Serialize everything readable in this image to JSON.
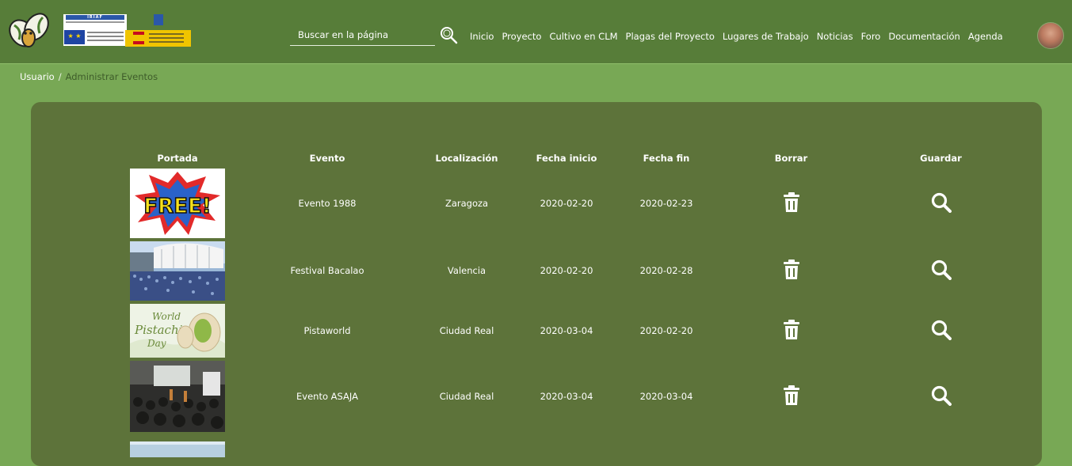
{
  "header": {
    "logo_iriaf_text": "IRIAF",
    "search": {
      "placeholder": "Buscar en la página",
      "value": ""
    },
    "nav": [
      "Inicio",
      "Proyecto",
      "Cultivo en CLM",
      "Plagas del Proyecto",
      "Lugares de Trabajo",
      "Noticias",
      "Foro",
      "Documentación",
      "Agenda"
    ]
  },
  "breadcrumb": {
    "parent": "Usuario",
    "separator": "/",
    "current": "Administrar Eventos"
  },
  "table": {
    "columns": [
      "Portada",
      "Evento",
      "Localización",
      "Fecha inicio",
      "Fecha fin",
      "Borrar",
      "Guardar"
    ],
    "rows": [
      {
        "evento": "Evento 1988",
        "localizacion": "Zaragoza",
        "fecha_inicio": "2020-02-20",
        "fecha_fin": "2020-02-23"
      },
      {
        "evento": "Festival Bacalao",
        "localizacion": "Valencia",
        "fecha_inicio": "2020-02-20",
        "fecha_fin": "2020-02-28"
      },
      {
        "evento": "Pistaworld",
        "localizacion": "Ciudad Real",
        "fecha_inicio": "2020-03-04",
        "fecha_fin": "2020-02-20"
      },
      {
        "evento": "Evento ASAJA",
        "localizacion": "Ciudad Real",
        "fecha_inicio": "2020-03-04",
        "fecha_fin": "2020-03-04"
      }
    ],
    "thumb_texts": {
      "free": "FREE!",
      "pistachio_line1": "World",
      "pistachio_line2": "Pistachio",
      "pistachio_line3": "Day"
    }
  },
  "colors": {
    "page_bg": "#78a855",
    "header_bg": "#577d39",
    "panel_bg": "#5d733a",
    "breadcrumb_current": "#3e5c2a"
  },
  "icons": {
    "search": "magnifier-icon",
    "delete": "trash-icon",
    "save": "search-icon"
  }
}
